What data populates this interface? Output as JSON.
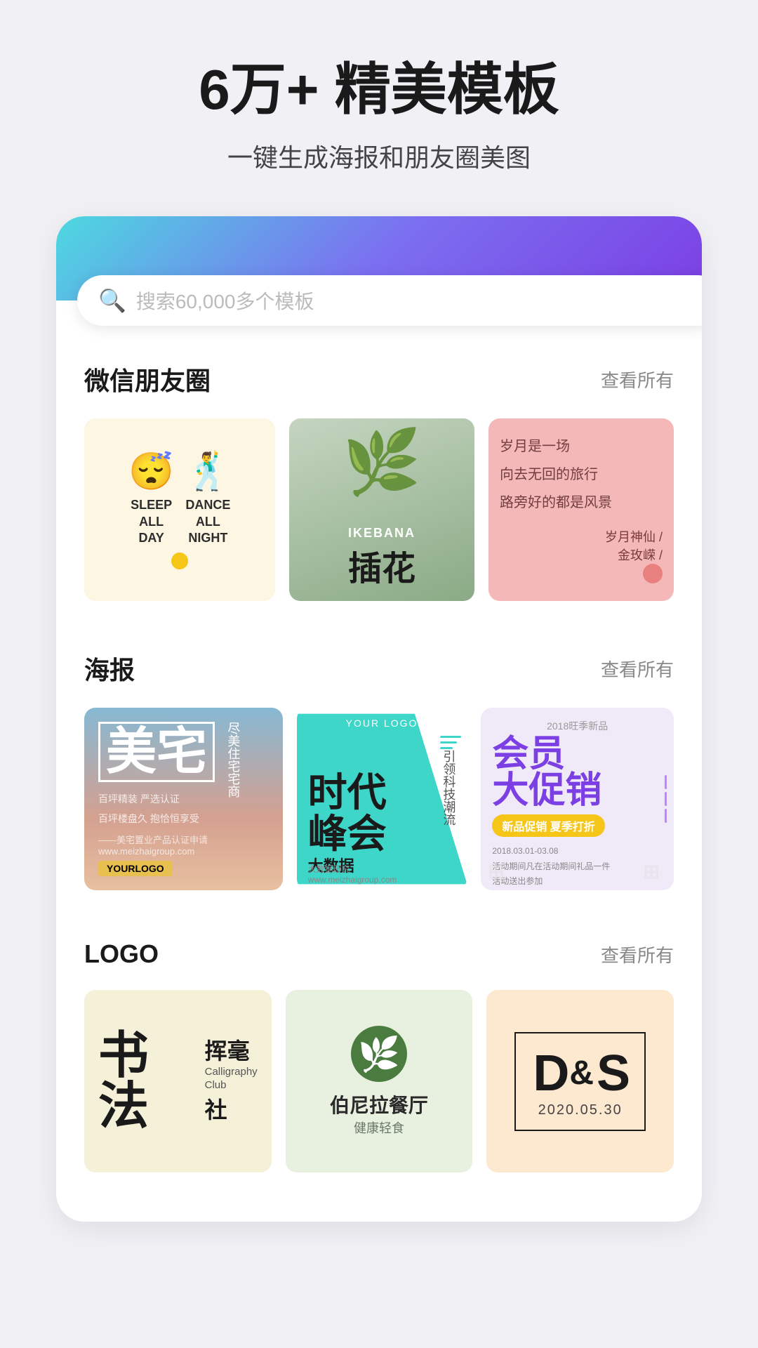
{
  "hero": {
    "title": "6万+ 精美模板",
    "subtitle": "一键生成海报和朋友圈美图"
  },
  "search": {
    "placeholder": "搜索60,000多个模板"
  },
  "sections": {
    "wechat": {
      "title": "微信朋友圈",
      "view_all": "查看所有"
    },
    "poster": {
      "title": "海报",
      "view_all": "查看所有"
    },
    "logo": {
      "title": "LOGO",
      "view_all": "查看所有"
    }
  },
  "wechat_templates": [
    {
      "id": "sleep-dance",
      "type": "sleep-dance",
      "text1": "SLEEP ALL DAY",
      "text2": "DANCE ALL NIGHT"
    },
    {
      "id": "ikebana",
      "type": "ikebana",
      "en": "IKEBANA",
      "zh": "插花"
    },
    {
      "id": "poem",
      "type": "poem",
      "lines": [
        "岁月是一场",
        "向去无回的旅行",
        "路旁好的都是风景"
      ],
      "author": "岁月神仙/",
      "author2": "金玫嵘/"
    }
  ],
  "poster_templates": [
    {
      "id": "meizhai",
      "title": "美宅",
      "subtitle": [
        "尽美",
        "住宅",
        "宅商"
      ]
    },
    {
      "id": "bigdata",
      "logo": "YOUR LOGO",
      "main": [
        "时代",
        "峰会"
      ],
      "sub": [
        "引领科技潮流",
        "大数据"
      ],
      "bottom": "大数据"
    },
    {
      "id": "member",
      "year": "2018旺季新品",
      "title": "会员",
      "title2": "大促销",
      "subtitle": "新品促销 夏季打折",
      "details": [
        "2018.03.01-03.08",
        "活动期间凡在活动期间礼品一件",
        "活动送出参加"
      ]
    }
  ],
  "logo_templates": [
    {
      "id": "calligraphy",
      "zh_main": "书法",
      "side1": "挥",
      "side2": "毫",
      "en1": "Calligraphy",
      "en2": "Club",
      "zh2": "社"
    },
    {
      "id": "restaurant",
      "name": "伯尼拉餐厅",
      "sub": "健康轻食"
    },
    {
      "id": "ds",
      "letters": "D&S",
      "date": "2020.05.30"
    }
  ],
  "colors": {
    "gradient_start": "#4dd9e0",
    "gradient_end": "#7b3fe4",
    "accent_purple": "#7b3fe4"
  }
}
